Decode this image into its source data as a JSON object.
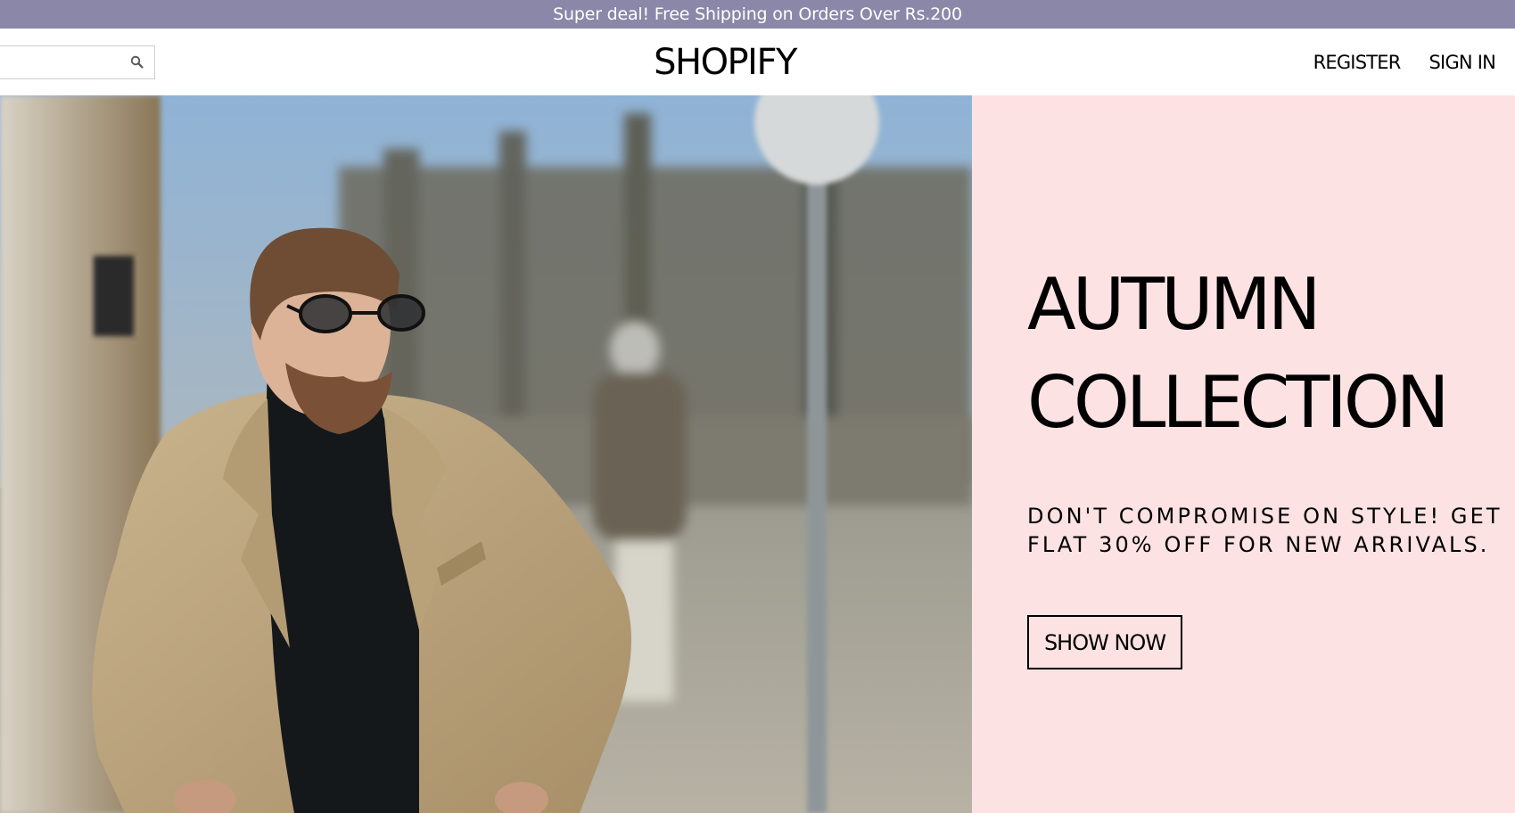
{
  "announcement": {
    "text": "Super deal! Free Shipping on Orders Over Rs.200"
  },
  "navbar": {
    "search": {
      "value": "",
      "placeholder": ""
    },
    "search_icon": "search-icon",
    "logo": "SHOPIFY",
    "links": {
      "register": "REGISTER",
      "sign_in": "SIGN IN"
    }
  },
  "hero": {
    "image_subject": "man-in-beige-coat-and-glasses-on-street",
    "title_line1": "AUTUMN",
    "title_line2": "COLLECTION",
    "subtitle": "DON'T COMPROMISE ON STYLE! GET FLAT 30% OFF FOR NEW ARRIVALS.",
    "cta": "SHOW NOW"
  },
  "colors": {
    "announcement_bg": "#8a87a8",
    "panel_bg": "#fde2e3",
    "text": "#000000"
  }
}
